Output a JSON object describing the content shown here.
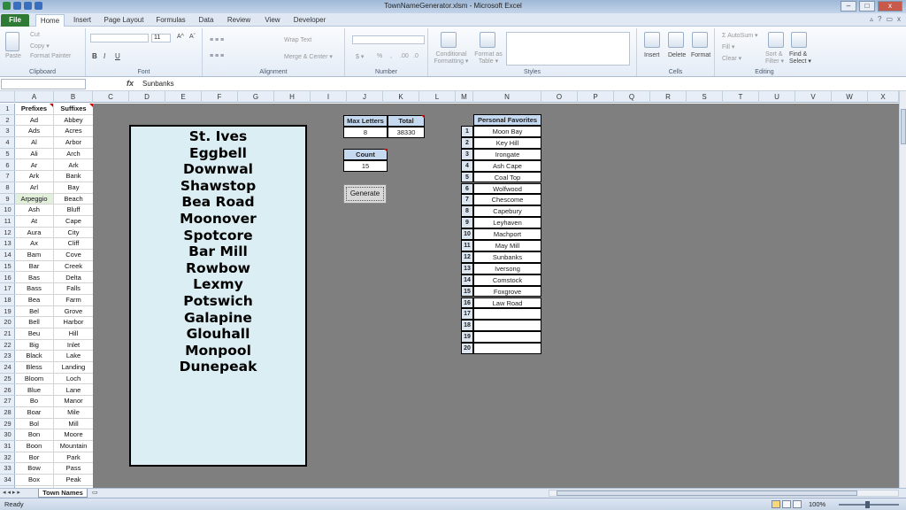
{
  "window": {
    "title": "TownNameGenerator.xlsm - Microsoft Excel",
    "minimize": "–",
    "maximize": "□",
    "close": "x"
  },
  "tabs": [
    {
      "label": "File"
    },
    {
      "label": "Home"
    },
    {
      "label": "Insert"
    },
    {
      "label": "Page Layout"
    },
    {
      "label": "Formulas"
    },
    {
      "label": "Data"
    },
    {
      "label": "Review"
    },
    {
      "label": "View"
    },
    {
      "label": "Developer"
    }
  ],
  "ribbon": {
    "clipboard": {
      "paste": "Paste",
      "cut": "Cut",
      "copy": "Copy ▾",
      "format_painter": "Format Painter",
      "label": "Clipboard"
    },
    "font": {
      "size": "11",
      "bold": "B",
      "italic": "I",
      "underline": "U",
      "grow": "A^",
      "shrink": "Aˇ",
      "label": "Font"
    },
    "alignment": {
      "wrap": "Wrap Text",
      "merge": "Merge & Center ▾",
      "label": "Alignment"
    },
    "number": {
      "currency": "$ ▾",
      "percent": "%",
      "comma": ",",
      "inc": ".00",
      "dec": ".0",
      "label": "Number"
    },
    "styles": {
      "conditional": "Conditional Formatting ▾",
      "as_table": "Format as Table ▾",
      "label": "Styles"
    },
    "cells": {
      "insert": "Insert",
      "delete": "Delete",
      "format": "Format",
      "label": "Cells"
    },
    "editing": {
      "autosum": "Σ AutoSum ▾",
      "fill": "Fill ▾",
      "clear": "Clear ▾",
      "sort": "Sort & Filter ▾",
      "find": "Find & Select ▾",
      "label": "Editing"
    }
  },
  "formula_bar": {
    "name_box": "",
    "fx": "fx",
    "value": "Sunbanks"
  },
  "columns": [
    "A",
    "B",
    "C",
    "D",
    "E",
    "F",
    "G",
    "H",
    "I",
    "J",
    "K",
    "L",
    "M",
    "N",
    "O",
    "P",
    "Q",
    "R",
    "S",
    "T",
    "U",
    "V",
    "W",
    "X"
  ],
  "rows": [
    "1",
    "2",
    "3",
    "4",
    "5",
    "6",
    "7",
    "8",
    "9",
    "10",
    "11",
    "12",
    "13",
    "14",
    "15",
    "16",
    "17",
    "18",
    "19",
    "20",
    "21",
    "22",
    "23",
    "24",
    "25",
    "26",
    "27",
    "28",
    "29",
    "30",
    "31",
    "32",
    "33",
    "34"
  ],
  "prefixes_header": "Prefixes",
  "suffixes_header": "Suffixes",
  "prefixes": [
    "Ad",
    "Ads",
    "Al",
    "Ali",
    "Ar",
    "Ark",
    "Arl",
    "Arpeggio",
    "Ash",
    "At",
    "Aura",
    "Ax",
    "Bam",
    "Bar",
    "Bas",
    "Bass",
    "Bea",
    "Bel",
    "Bell",
    "Beu",
    "Big",
    "Black",
    "Bless",
    "Bloom",
    "Blue",
    "Bo",
    "Boar",
    "Bol",
    "Bon",
    "Boon",
    "Bor",
    "Bow",
    "Box"
  ],
  "suffixes": [
    "Abbey",
    "Acres",
    "Arbor",
    "Arch",
    "Ark",
    "Bank",
    "Bay",
    "Beach",
    "Bluff",
    "Cape",
    "City",
    "Cliff",
    "Cove",
    "Creek",
    "Delta",
    "Falls",
    "Farm",
    "Grove",
    "Harbor",
    "Hill",
    "Inlet",
    "Lake",
    "Landing",
    "Loch",
    "Lane",
    "Manor",
    "Mile",
    "Mill",
    "Moore",
    "Mountain",
    "Park",
    "Pass",
    "Peak"
  ],
  "generated_names": [
    "St. Ives",
    "Eggbell",
    "Downwal",
    "Shawstop",
    "Bea Road",
    "Moonover",
    "Spotcore",
    "Bar Mill",
    "Rowbow",
    "Lexmy",
    "Potswich",
    "Galapine",
    "Glouhall",
    "Monpool",
    "Dunepeak"
  ],
  "controls": {
    "max_letters_label": "Max Letters",
    "max_letters_value": "8",
    "total_label": "Total",
    "total_value": "38330",
    "count_label": "Count",
    "count_value": "15",
    "generate_button": "Generate"
  },
  "favorites": {
    "header": "Personal Favorites",
    "numbers": [
      "1",
      "2",
      "3",
      "4",
      "5",
      "6",
      "7",
      "8",
      "9",
      "10",
      "11",
      "12",
      "13",
      "14",
      "15",
      "16",
      "17",
      "18",
      "19",
      "20"
    ],
    "names": [
      "Moon Bay",
      "Key Hill",
      "Irongate",
      "Ash Cape",
      "Coal Top",
      "Wolfwood",
      "Chescome",
      "Capebury",
      "Leyhaven",
      "Machport",
      "May Mill",
      "Sunbanks",
      "Iversong",
      "Comstock",
      "Foxgrove",
      "Law Road",
      "",
      "",
      "",
      ""
    ]
  },
  "sheet_tab": "Town Names",
  "status": {
    "ready": "Ready",
    "zoom": "100%"
  }
}
